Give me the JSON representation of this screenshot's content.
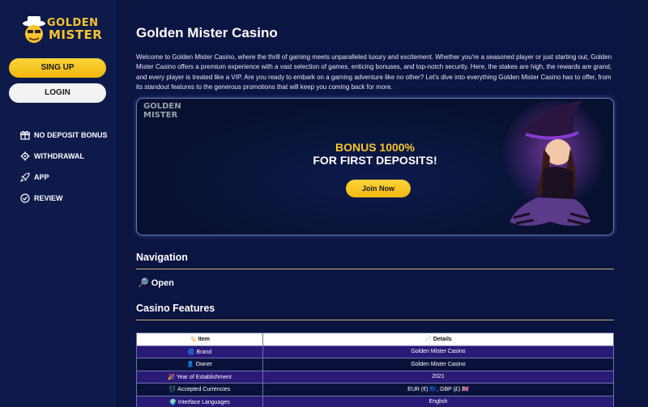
{
  "sidebar": {
    "logo": {
      "line1": "GOLDEN",
      "line2": "MISTER"
    },
    "signup_label": "SING UP",
    "login_label": "LOGIN",
    "nav": [
      {
        "label": "NO DEPOSIT BONUS",
        "icon": "gift-icon"
      },
      {
        "label": "WITHDRAWAL",
        "icon": "gear-icon"
      },
      {
        "label": "APP",
        "icon": "rocket-icon"
      },
      {
        "label": "REVIEW",
        "icon": "check-circle-icon"
      }
    ]
  },
  "main": {
    "title": "Golden Mister Casino",
    "intro": "Welcome to Golden Mister Casino, where the thrill of gaming meets unparalleled luxury and excitement. Whether you're a seasoned player or just starting out, Golden Mister Casino offers a premium experience with a vast selection of games, enticing bonuses, and top-notch security. Here, the stakes are high, the rewards are grand, and every player is treated like a VIP. Are you ready to embark on a gaming adventure like no other? Let's dive into everything Golden Mister Casino has to offer, from its standout features to the generous promotions that will keep you coming back for more.",
    "banner": {
      "logo_line1": "GOLDEN",
      "logo_line2": "MISTER",
      "bonus_line1": "BONUS 1000%",
      "bonus_line2": "FOR FIRST DEPOSITS!",
      "cta": "Join Now"
    },
    "navigation_title": "Navigation",
    "open_label": "🔎 Open",
    "features_title": "Casino Features",
    "table": {
      "headers": [
        "🏷️ Item",
        "📄 Details"
      ],
      "rows": [
        [
          "🌀 Brand",
          "Golden Mister Casino"
        ],
        [
          "👤 Owner",
          "Golden Mister Casino"
        ],
        [
          "🎉 Year of Establishment",
          "2021"
        ],
        [
          "💱 Accepted Currencies",
          "EUR (€) 🇪🇺, GBP (£) 🇬🇧"
        ],
        [
          "🌍 Interface Languages",
          "English"
        ]
      ]
    }
  },
  "colors": {
    "accent_gold": "#f7c531",
    "background": "#0b1540",
    "table_odd_row": "#2a1a78"
  }
}
